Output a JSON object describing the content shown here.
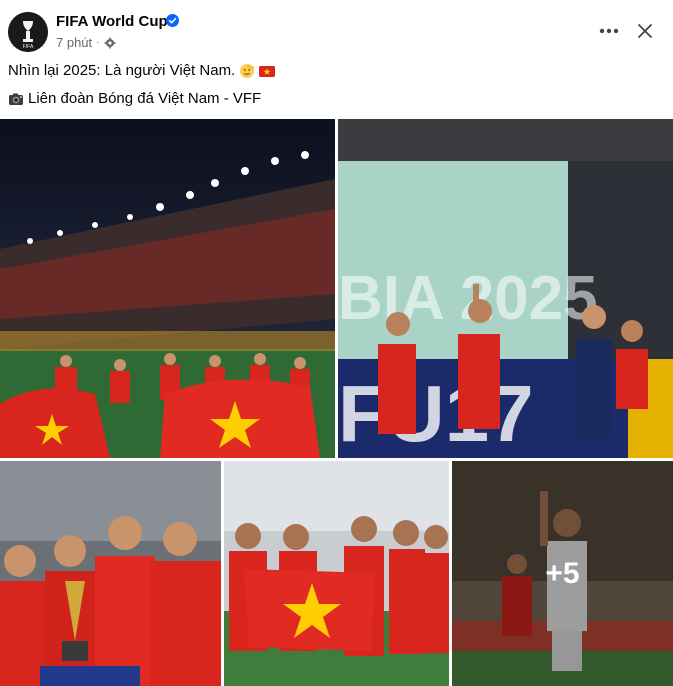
{
  "header": {
    "page_name": "FIFA World Cup",
    "time": "7 phút",
    "separator": "·",
    "icons": {
      "avatar": "fifa-world-cup-logo",
      "verified": "verified-badge-icon",
      "audience": "gear-icon",
      "more": "more-horizontal-icon",
      "close": "close-icon"
    }
  },
  "post": {
    "caption": "Nhìn lại 2025: Là người Việt Nam.",
    "caption_emojis": [
      "saluting-face-emoji",
      "vietnam-flag-emoji"
    ],
    "credit_icon": "camera-emoji",
    "credit": "Liên đoàn Bóng đá Việt Nam - VFF"
  },
  "gallery": {
    "photos": [
      {
        "description_name": "team-celebration-stadium"
      },
      {
        "description_name": "u17-goal-celebration"
      },
      {
        "description_name": "trophy-heart-celebration"
      },
      {
        "description_name": "women-team-flag"
      },
      {
        "description_name": "player-pointing"
      }
    ],
    "more_count": "+5"
  },
  "colors": {
    "verified_blue": "#0866ff",
    "secondary_text": "#65676b",
    "vn_red": "#da251d",
    "vn_yellow": "#ffcd00"
  }
}
